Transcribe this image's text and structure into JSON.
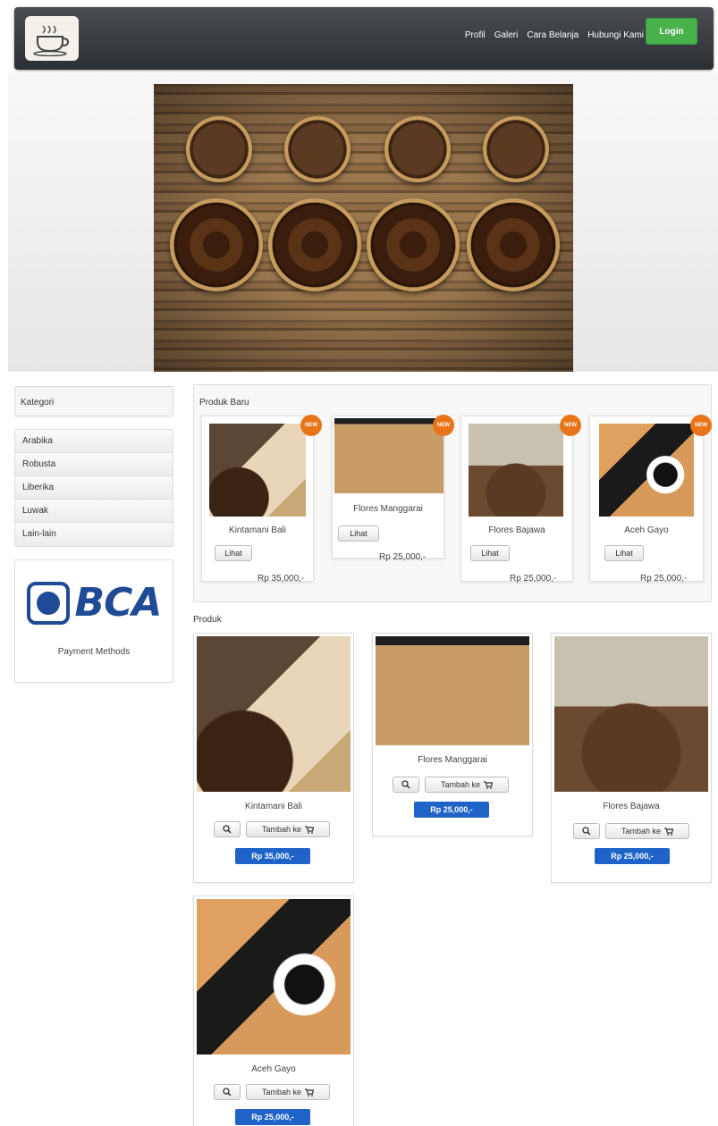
{
  "nav": {
    "links": [
      "Profil",
      "Galeri",
      "Cara Belanja",
      "Hubungi Kami"
    ],
    "login_label": "Login"
  },
  "sidebar": {
    "heading": "Kategori",
    "categories": [
      "Arabika",
      "Robusta",
      "Liberika",
      "Luwak",
      "Lain-lain"
    ],
    "bank_logo_text": "BCA",
    "payment_label": "Payment Methods"
  },
  "new_products": {
    "title": "Produk Baru",
    "badge": "NEW",
    "view_label": "Lihat",
    "items": [
      {
        "name": "Kintamani Bali",
        "price": "Rp 35,000,-"
      },
      {
        "name": "Flores Manggarai",
        "price": "Rp 25,000,-"
      },
      {
        "name": "Flores Bajawa",
        "price": "Rp 25,000,-"
      },
      {
        "name": "Aceh Gayo",
        "price": "Rp 25,000,-"
      }
    ]
  },
  "products": {
    "title": "Produk",
    "add_label": "Tambah ke",
    "items": [
      {
        "name": "Kintamani Bali",
        "price": "Rp 35,000,-"
      },
      {
        "name": "Flores Manggarai",
        "price": "Rp 25,000,-"
      },
      {
        "name": "Flores Bajawa",
        "price": "Rp 25,000,-"
      },
      {
        "name": "Aceh Gayo",
        "price": "Rp 25,000,-"
      }
    ]
  },
  "icons": {
    "magnify": "magnify-icon",
    "cart": "cart-icon",
    "cup": "coffee-cup-icon"
  },
  "colors": {
    "login": "#48b14a",
    "price_badge": "#1f63c8",
    "new_badge": "#e8741a",
    "bca": "#1f4b96"
  }
}
